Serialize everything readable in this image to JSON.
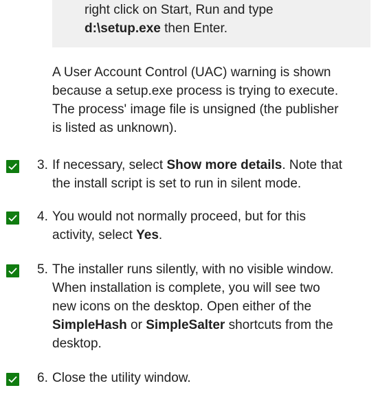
{
  "note": {
    "line1": "right click on Start, Run and type",
    "cmd": "d:\\setup.exe",
    "line2_rest": " then Enter."
  },
  "uac_paragraph": {
    "lines": [
      "A User Account Control (UAC) warning is shown",
      "because a setup.exe process is trying to execute.",
      "The process' image file is unsigned (the publisher",
      "is listed as unknown)."
    ]
  },
  "steps": [
    {
      "number": "3.",
      "checked": true,
      "l1_pre": "If necessary, select ",
      "l1_bold": "Show more details",
      "l1_post": ". Note that",
      "l2": "the install script is set to run in silent mode."
    },
    {
      "number": "4.",
      "checked": true,
      "l1": "You would not normally proceed, but for this",
      "l2_pre": "activity, select ",
      "l2_bold": "Yes",
      "l2_post": "."
    },
    {
      "number": "5.",
      "checked": true,
      "l1": "The installer runs silently, with no visible window.",
      "l2": "When installation is complete, you will see two",
      "l3": "new icons on the desktop. Open either of the",
      "l4_bold1": "SimpleHash",
      "l4_mid": " or ",
      "l4_bold2": "SimpleSalter",
      "l4_post": " shortcuts from the",
      "l5": "desktop."
    },
    {
      "number": "6.",
      "checked": true,
      "l1": "Close the utility window."
    }
  ],
  "colors": {
    "checkbox": "#107c10",
    "note_background": "#f0f0f0"
  },
  "icons": {
    "checkbox": "checkmark-icon"
  }
}
